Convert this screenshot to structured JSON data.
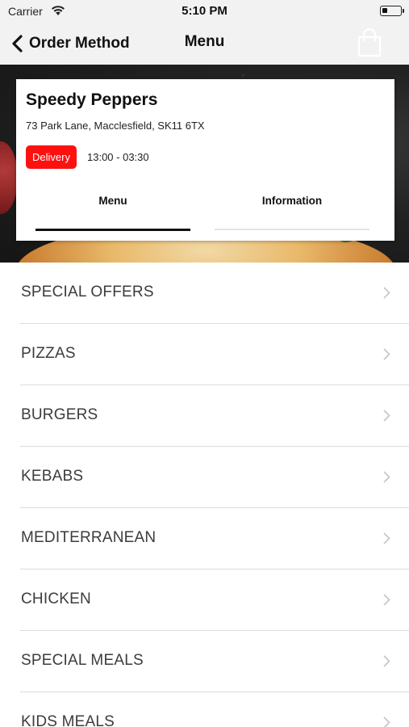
{
  "status_bar": {
    "carrier": "Carrier",
    "time": "5:10 PM",
    "battery_level": 0.3
  },
  "nav": {
    "back_label": "Order Method",
    "title": "Menu",
    "back_icon": "chevron-left-icon",
    "cart_icon": "shopping-bag-icon"
  },
  "restaurant": {
    "name": "Speedy Peppers",
    "address": "73 Park Lane, Macclesfield, SK11 6TX",
    "order_type": "Delivery",
    "hours": "13:00 - 03:30"
  },
  "tabs": [
    {
      "label": "Menu",
      "active": true
    },
    {
      "label": "Information",
      "active": false
    }
  ],
  "categories": [
    "SPECIAL OFFERS",
    "PIZZAS",
    "BURGERS",
    "KEBABS",
    "MEDITERRANEAN",
    "CHICKEN",
    "SPECIAL MEALS",
    "KIDS MEALS"
  ],
  "colors": {
    "accent_red": "#ff1010",
    "nav_background": "#f2f2f2",
    "separator": "#dcdcdc",
    "list_text": "#3c3c3c"
  }
}
